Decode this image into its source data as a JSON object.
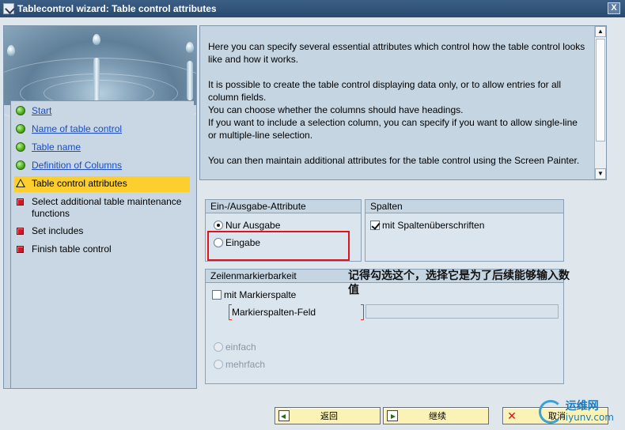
{
  "window": {
    "title": "Tablecontrol wizard: Table control attributes",
    "close_label": "X"
  },
  "steps": [
    {
      "label": "Start",
      "status": "done",
      "link": true
    },
    {
      "label": "Name of table control",
      "status": "done",
      "link": true
    },
    {
      "label": "Table name",
      "status": "done",
      "link": true
    },
    {
      "label": "Definition of Columns",
      "status": "done",
      "link": true
    },
    {
      "label": "Table control attributes",
      "status": "current",
      "link": false
    },
    {
      "label": "Select additional table maintenance functions",
      "status": "pending",
      "link": false
    },
    {
      "label": "Set includes",
      "status": "pending",
      "link": false
    },
    {
      "label": "Finish table control",
      "status": "pending",
      "link": false
    }
  ],
  "description": {
    "p1": "Here you can specify several essential attributes which control how the table control looks like and how it works.",
    "p2": "It is possible to create the table control displaying data only, or to allow entries for all column fields.",
    "p3": "You can choose whether the columns should have headings.",
    "p4": "If you want to include a selection column, you can specify if you want to allow single-line or multiple-line selection.",
    "p5": "You can then maintain additional attributes for the table control using the Screen Painter."
  },
  "io_group": {
    "title": "Ein-/Ausgabe-Attribute",
    "option_output": "Nur Ausgabe",
    "option_input": "Eingabe",
    "selected": "Nur Ausgabe"
  },
  "columns_group": {
    "title": "Spalten",
    "headings_label": "mit Spaltenüberschriften",
    "headings_checked": true
  },
  "selection_group": {
    "title": "Zeilenmarkierbarkeit",
    "mark_column_label": "mit Markierspalte",
    "mark_column_checked": false,
    "field_label": "Markierspalten-Feld",
    "field_value": "",
    "single_label": "einfach",
    "multiple_label": "mehrfach"
  },
  "annotation": "记得勾选这个，选择它是为了后续能够输入数值",
  "buttons": {
    "back": "返回",
    "next": "继续",
    "cancel": "取消"
  },
  "watermark": {
    "name": "运维网",
    "url": "iyunv.com"
  },
  "colors": {
    "active_step": "#fccf2e",
    "highlight_box": "#e0121b",
    "link": "#1a4cc4",
    "button_bg": "#fbf3b6"
  }
}
